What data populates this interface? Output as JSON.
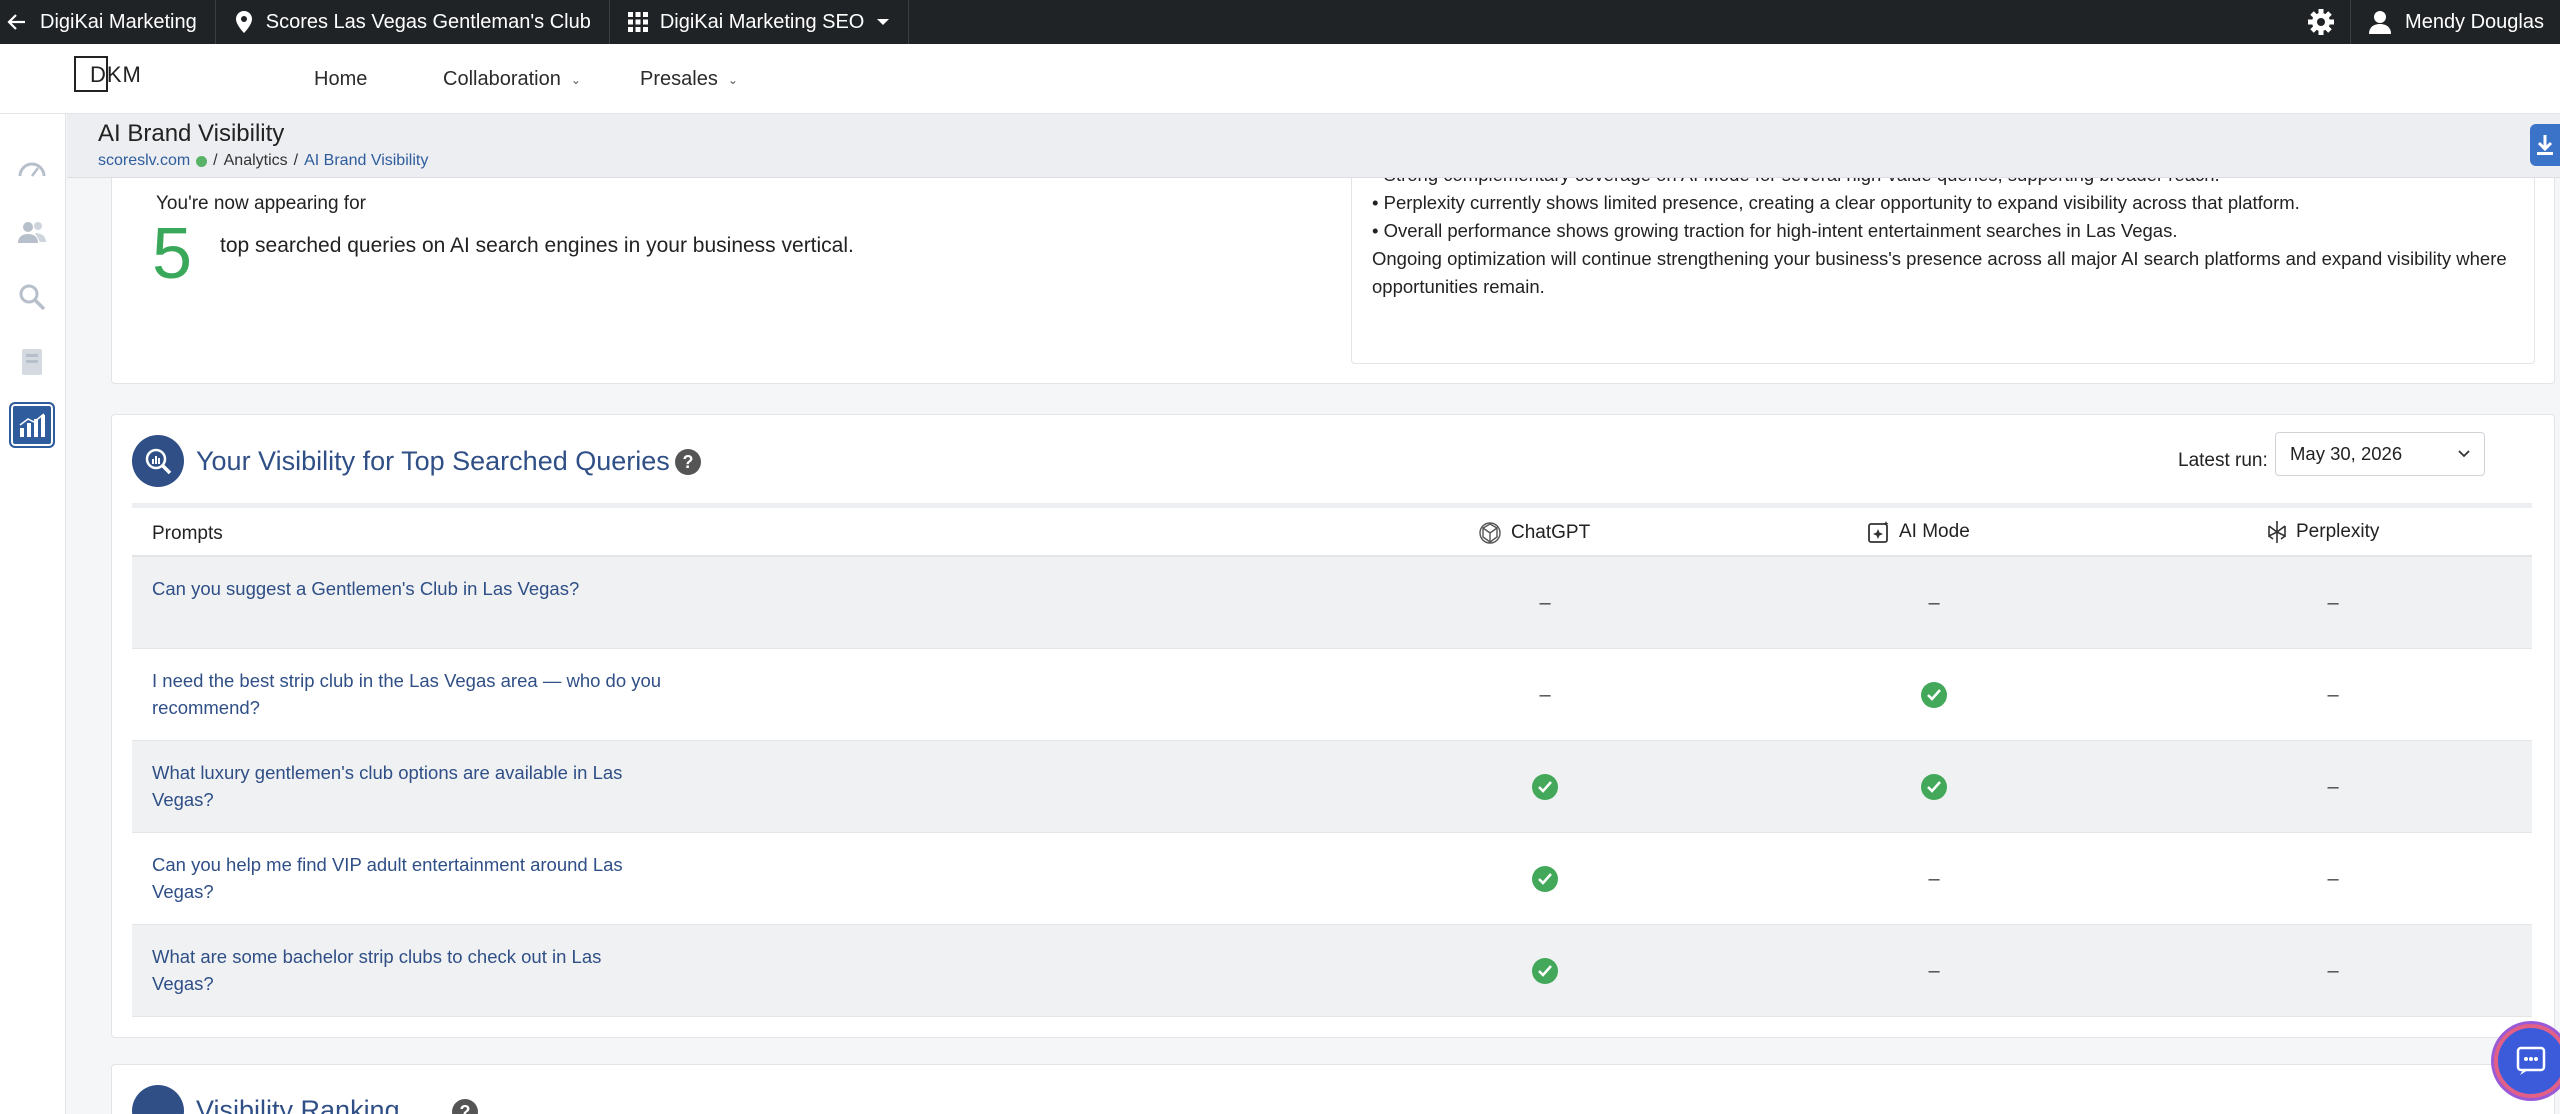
{
  "topbar": {
    "back_label": "DigiKai Marketing",
    "location_label": "Scores Las Vegas Gentleman's Club",
    "apps_label": "DigiKai Marketing SEO",
    "user_name": "Mendy Douglas"
  },
  "nav": {
    "logo": "DKM",
    "home": "Home",
    "collaboration": "Collaboration",
    "presales": "Presales"
  },
  "header": {
    "title": "AI Brand Visibility",
    "crumb_site": "scoreslv.com",
    "crumb_sep": "/",
    "crumb_analytics": "Analytics",
    "crumb_current": "AI Brand Visibility"
  },
  "summary": {
    "appearing_text": "You're now appearing for",
    "count": "5",
    "count_desc": "top searched queries on AI search engines in your business vertical.",
    "bullets": [
      "• Strong complementary coverage on AI Mode for several high-value queries, supporting broader reach.",
      "• Perplexity currently shows limited presence, creating a clear opportunity to expand visibility across that platform.",
      "• Overall performance shows growing traction for high-intent entertainment searches in Las Vegas.",
      "Ongoing optimization will continue strengthening your business's presence across all major AI search platforms and expand visibility where opportunities remain."
    ]
  },
  "visibility": {
    "title": "Your Visibility for Top Searched Queries",
    "latest_run_label": "Latest run:",
    "latest_run_value": "May 30, 2026",
    "columns": {
      "prompts": "Prompts",
      "chatgpt": "ChatGPT",
      "aimode": "AI Mode",
      "perplexity": "Perplexity"
    },
    "rows": [
      {
        "prompt": "Can you suggest a Gentlemen's Club in Las Vegas?",
        "chatgpt": false,
        "aimode": false,
        "perplexity": false
      },
      {
        "prompt": "I need the best strip club in the Las Vegas area — who do you recommend?",
        "chatgpt": false,
        "aimode": true,
        "perplexity": false
      },
      {
        "prompt": "What luxury gentlemen's club options are available in Las Vegas?",
        "chatgpt": true,
        "aimode": true,
        "perplexity": false
      },
      {
        "prompt": "Can you help me find VIP adult entertainment around Las Vegas?",
        "chatgpt": true,
        "aimode": false,
        "perplexity": false
      },
      {
        "prompt": "What are some bachelor strip clubs to check out in Las Vegas?",
        "chatgpt": true,
        "aimode": false,
        "perplexity": false
      }
    ],
    "dash": "–"
  },
  "ranking": {
    "title": "Visibility Ranking"
  },
  "colors": {
    "accent": "#2f4f86",
    "success": "#43a85a",
    "big_number": "#3aa85a"
  }
}
